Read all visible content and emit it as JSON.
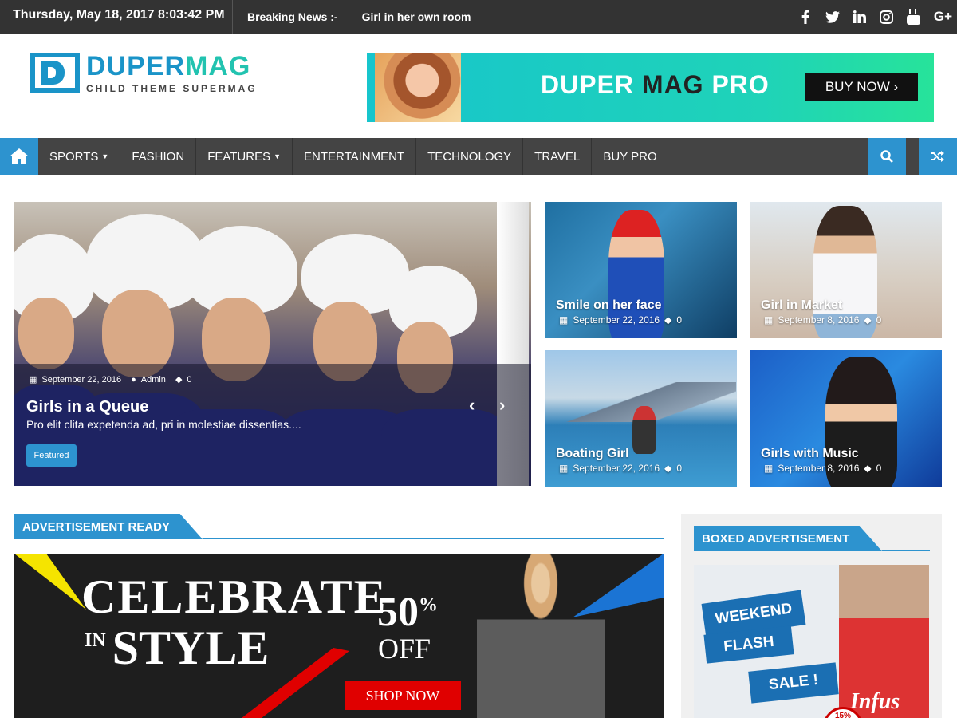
{
  "topbar": {
    "datetime": "Thursday, May 18, 2017  8:03:42 PM",
    "breaking_label": "Breaking News :-",
    "breaking_text": "Girl in her own room",
    "social": [
      "f",
      "t",
      "in",
      "ig",
      "yt",
      "G+"
    ]
  },
  "header": {
    "logo_title_a": "DUPER",
    "logo_title_b": "MAG",
    "logo_sub": "CHILD THEME SUPERMAG",
    "banner_title_a": "DUPER ",
    "banner_title_b": "MAG",
    "banner_title_c": " PRO",
    "banner_button": "BUY NOW ›"
  },
  "nav": {
    "items": [
      "SPORTS",
      "FASHION",
      "FEATURES",
      "ENTERTAINMENT",
      "TECHNOLOGY",
      "TRAVEL",
      "BUY PRO"
    ]
  },
  "slider": {
    "date": "September 22, 2016",
    "author": "Admin",
    "comments": "0",
    "title": "Girls in a Queue",
    "desc": "Pro elit clita expetenda ad, pri in molestiae dissentias....",
    "badge": "Featured",
    "prev": "‹",
    "next": "›"
  },
  "tiles": [
    {
      "title": "Smile on her face",
      "date": "September 22, 2016",
      "comments": "0"
    },
    {
      "title": "Girl in Market",
      "date": "September 8, 2016",
      "comments": "0"
    },
    {
      "title": "Boating Girl",
      "date": "September 22, 2016",
      "comments": "0"
    },
    {
      "title": "Girls with Music",
      "date": "September 8, 2016",
      "comments": "0"
    }
  ],
  "sections": {
    "ad_ready": "ADVERTISEMENT READY",
    "boxed_ad": "BOXED ADVERTISEMENT"
  },
  "ad_main": {
    "celebrate": "CELEBRATE",
    "in": "IN",
    "style": "STYLE",
    "pct": "50",
    "pct_sign": "%",
    "off": "OFF",
    "shop": "SHOP NOW"
  },
  "side_ad": {
    "weekend": "WEEKEND",
    "flash": "FLASH",
    "sale": "SALE !",
    "shirt": "Infus",
    "badge": "15%"
  },
  "colors": {
    "accent": "#2d93cf",
    "topbar": "#333333",
    "nav": "#444444"
  }
}
